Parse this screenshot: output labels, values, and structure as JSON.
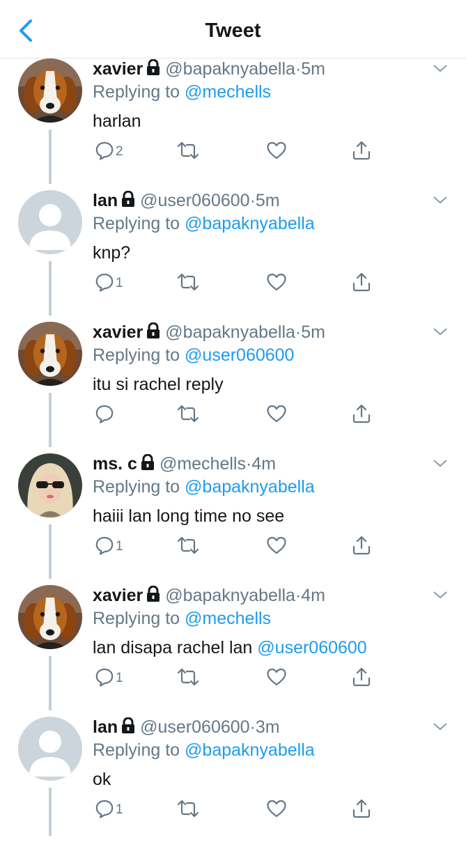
{
  "header": {
    "title": "Tweet"
  },
  "tweets": [
    {
      "name": "xavier",
      "handle": "@bapaknyabella",
      "sep": "·",
      "time": "5m",
      "replying_prefix": "Replying to ",
      "replying_to": "@mechells",
      "text": "harlan",
      "mention": "",
      "reply_count": "2",
      "avatar": "dog"
    },
    {
      "name": "lan",
      "handle": "@user060600",
      "sep": "·",
      "time": "5m",
      "replying_prefix": "Replying to ",
      "replying_to": "@bapaknyabella",
      "text": "knp?",
      "mention": "",
      "reply_count": "1",
      "avatar": "default"
    },
    {
      "name": "xavier",
      "handle": "@bapaknyabella",
      "sep": "·",
      "time": "5m",
      "replying_prefix": "Replying to ",
      "replying_to": "@user060600",
      "text": "itu si rachel reply",
      "mention": "",
      "reply_count": "",
      "avatar": "dog"
    },
    {
      "name": "ms. c",
      "handle": "@mechells",
      "sep": "·",
      "time": "4m",
      "replying_prefix": "Replying to ",
      "replying_to": "@bapaknyabella",
      "text": "haiii lan long time no see",
      "mention": "",
      "reply_count": "1",
      "avatar": "photo"
    },
    {
      "name": "xavier",
      "handle": "@bapaknyabella",
      "sep": "·",
      "time": "4m",
      "replying_prefix": "Replying to ",
      "replying_to": "@mechells",
      "text": "lan disapa rachel lan ",
      "mention": "@user060600",
      "reply_count": "1",
      "avatar": "dog"
    },
    {
      "name": "lan",
      "handle": "@user060600",
      "sep": "·",
      "time": "3m",
      "replying_prefix": "Replying to ",
      "replying_to": "@bapaknyabella",
      "text": "ok",
      "mention": "",
      "reply_count": "1",
      "avatar": "default"
    }
  ],
  "icons": {
    "back": "chevron-left-icon",
    "lock": "lock-icon",
    "caret": "chevron-down-icon",
    "reply": "reply-icon",
    "retweet": "retweet-icon",
    "like": "heart-icon",
    "share": "share-icon"
  },
  "colors": {
    "accent": "#1d9bf0",
    "secondary_text": "#657786",
    "thread_line": "#c4cfd6"
  }
}
